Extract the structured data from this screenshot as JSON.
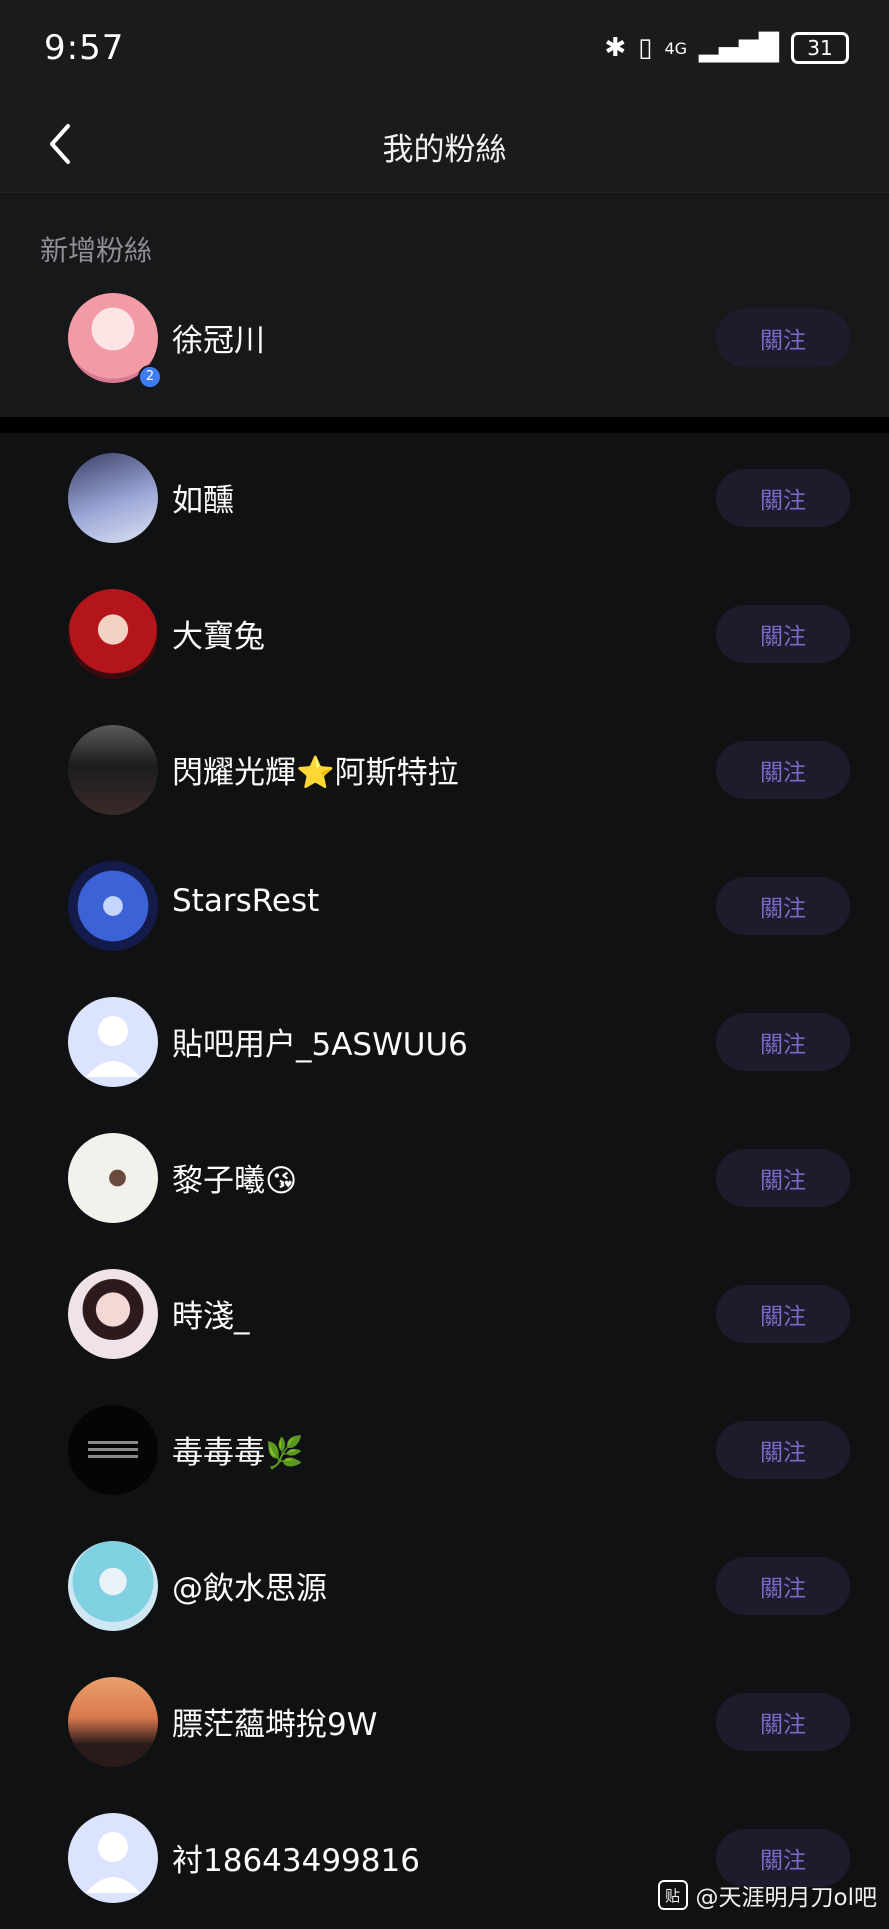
{
  "status_bar": {
    "time": "9:57",
    "network": "4G",
    "battery": "31"
  },
  "header": {
    "title": "我的粉絲"
  },
  "new_section": {
    "label": "新增粉絲",
    "item": {
      "name": "徐冠川",
      "badge": "2",
      "follow_label": "關注"
    }
  },
  "followers": [
    {
      "name": "如醺",
      "follow_label": "關注"
    },
    {
      "name": "大寶兔",
      "follow_label": "關注"
    },
    {
      "name": "閃耀光輝⭐阿斯特拉",
      "follow_label": "關注"
    },
    {
      "name": "StarsRest",
      "follow_label": "關注"
    },
    {
      "name": "貼吧用户_5ASWUU6",
      "follow_label": "關注"
    },
    {
      "name": "黎子曦😘",
      "follow_label": "關注"
    },
    {
      "name": "時淺_",
      "follow_label": "關注"
    },
    {
      "name": "毒毒毒🌿",
      "follow_label": "關注"
    },
    {
      "name": "@飲水思源",
      "follow_label": "關注"
    },
    {
      "name": "膘茫蘊塒挩9W",
      "follow_label": "關注"
    },
    {
      "name": "衬18643499816",
      "follow_label": "關注"
    }
  ],
  "watermark": {
    "icon_text": "贴",
    "text": "@天涯明月刀ol吧"
  }
}
